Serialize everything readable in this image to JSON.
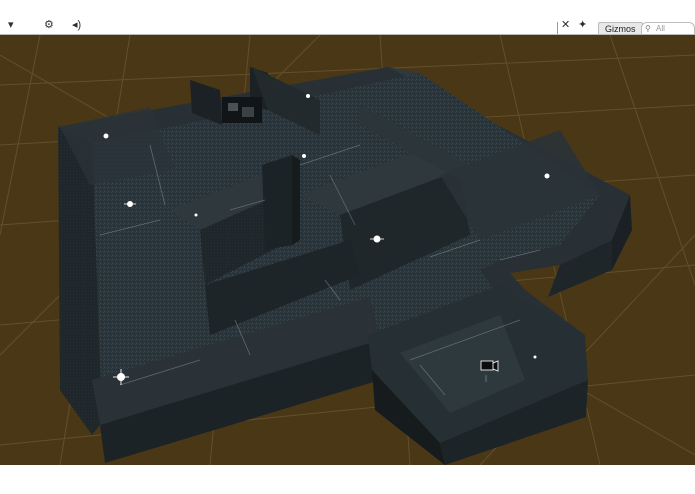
{
  "toolbar": {
    "left_icons": [
      "dropdown-arrow-icon",
      "settings-icon",
      "audio-icon"
    ],
    "left_glyphs": [
      "▾",
      "⚙",
      "◂)"
    ],
    "right_icons": [
      "scene-camera-icon",
      "tools-icon"
    ],
    "right_glyphs": [
      "✕",
      "✦"
    ],
    "gizmos_label": "Gizmos",
    "search_placeholder": "All",
    "search_glyph": "⚲"
  },
  "scene": {
    "background_color": "#4a3716",
    "grid_color": "#7a6340",
    "wall_colors": {
      "top": "#2e363a",
      "front": "#1f2629",
      "side": "#181e20",
      "floor": "#28343a"
    },
    "light_gizmo_icon": "light-bulb-icon",
    "camera_gizmo_icon": "camera-icon",
    "light_count": 9
  }
}
